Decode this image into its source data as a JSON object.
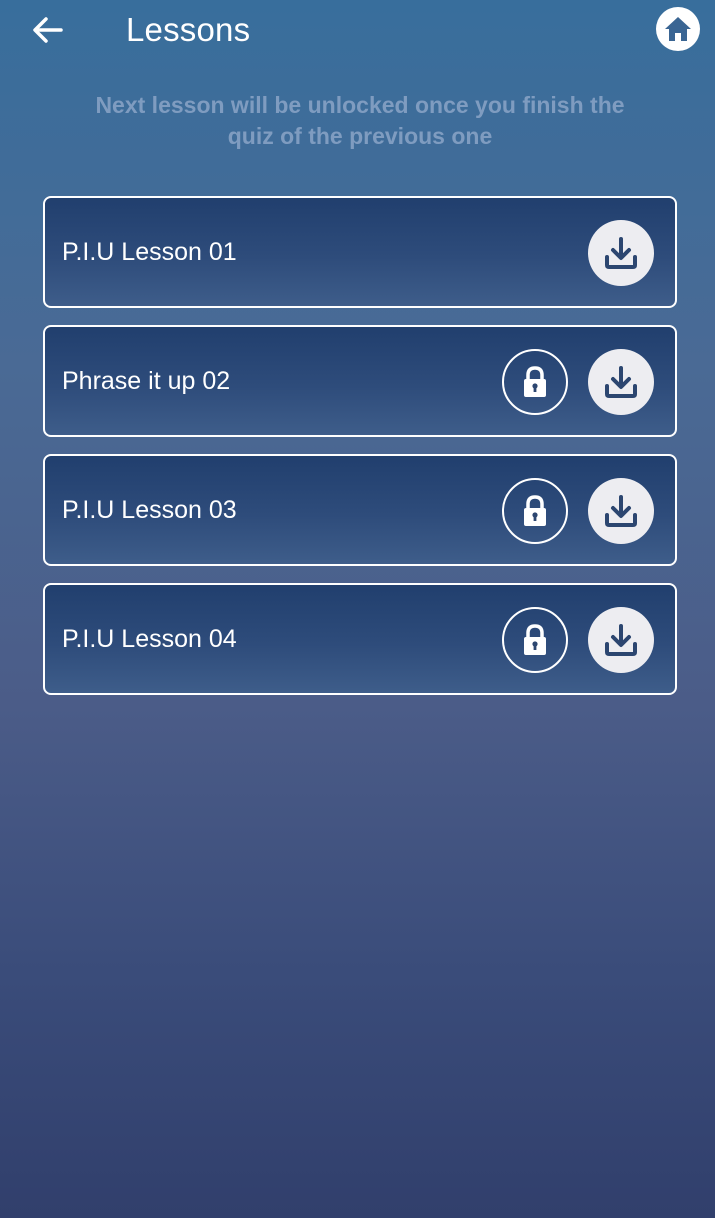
{
  "header": {
    "back_icon": "arrow-left-icon",
    "title": "Lessons",
    "home_icon": "home-icon"
  },
  "notice": {
    "line1": "Next lesson will be unlocked once you finish the",
    "line2": "quiz of the previous one"
  },
  "colors": {
    "card_border": "#ffffff",
    "notice_text": "#7f9cc0",
    "download_bg": "#ededf1",
    "icon_fg": "#2c4670"
  },
  "lessons": [
    {
      "label": "P.I.U Lesson 01",
      "locked": false,
      "icons": [
        "download-icon"
      ]
    },
    {
      "label": "Phrase it up 02",
      "locked": true,
      "icons": [
        "lock-icon",
        "download-icon"
      ]
    },
    {
      "label": "P.I.U Lesson 03",
      "locked": true,
      "icons": [
        "lock-icon",
        "download-icon"
      ]
    },
    {
      "label": "P.I.U Lesson 04",
      "locked": true,
      "icons": [
        "lock-icon",
        "download-icon"
      ]
    }
  ]
}
